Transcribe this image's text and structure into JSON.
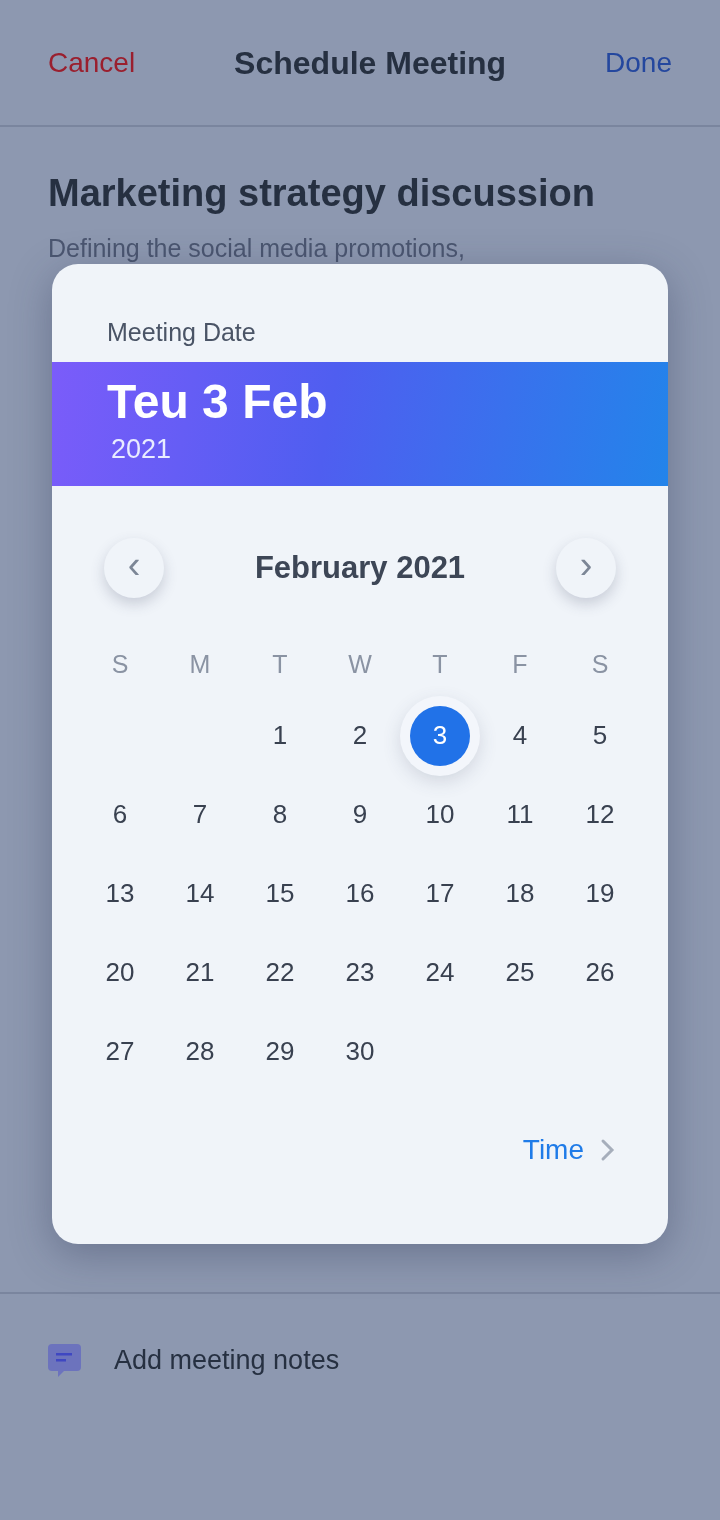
{
  "header": {
    "cancel": "Cancel",
    "title": "Schedule Meeting",
    "done": "Done"
  },
  "meeting": {
    "title": "Marketing strategy discussion",
    "description": "Defining the social media promotions,"
  },
  "notes": {
    "label": "Add meeting notes"
  },
  "date_picker": {
    "label": "Meeting Date",
    "selected_date": "Teu 3 Feb",
    "selected_year": "2021",
    "month": "February 2021",
    "prev": "‹",
    "next": "›",
    "weekdays": [
      "S",
      "M",
      "T",
      "W",
      "T",
      "F",
      "S"
    ],
    "weeks": [
      {
        "days": [
          {
            "kind": "blank"
          },
          {
            "kind": "blank"
          },
          {
            "kind": "day",
            "day": "1",
            "selected": false
          },
          {
            "day": "2",
            "selected": false
          },
          {
            "day": "3",
            "selected": true
          },
          {
            "day": "4",
            "selected": false
          },
          {
            "day": "5",
            "selected": false
          }
        ]
      },
      {
        "days": [
          {
            "day": "6",
            "selected": false
          },
          {
            "day": "7",
            "selected": false
          },
          {
            "day": "8",
            "selected": false
          },
          {
            "day": "9",
            "selected": false
          },
          {
            "day": "10",
            "selected": false
          },
          {
            "day": "11",
            "selected": false
          },
          {
            "day": "12",
            "selected": false
          }
        ]
      },
      {
        "days": [
          {
            "day": "13",
            "selected": false
          },
          {
            "day": "14",
            "selected": false
          },
          {
            "day": "15",
            "selected": false
          },
          {
            "day": "16",
            "selected": false
          },
          {
            "day": "17",
            "selected": false
          },
          {
            "day": "18",
            "selected": false
          },
          {
            "day": "19",
            "selected": false
          }
        ]
      },
      {
        "days": [
          {
            "day": "20",
            "selected": false
          },
          {
            "day": "21",
            "selected": false
          },
          {
            "day": "22",
            "selected": false
          },
          {
            "day": "23",
            "selected": false
          },
          {
            "day": "24",
            "selected": false
          },
          {
            "day": "25",
            "selected": false
          },
          {
            "day": "26",
            "selected": false
          }
        ]
      },
      {
        "days": [
          {
            "day": "27",
            "selected": false
          },
          {
            "day": "28",
            "selected": false
          },
          {
            "day": "29",
            "selected": false
          },
          {
            "day": "30",
            "selected": false
          }
        ]
      }
    ],
    "time_link": "Time"
  }
}
